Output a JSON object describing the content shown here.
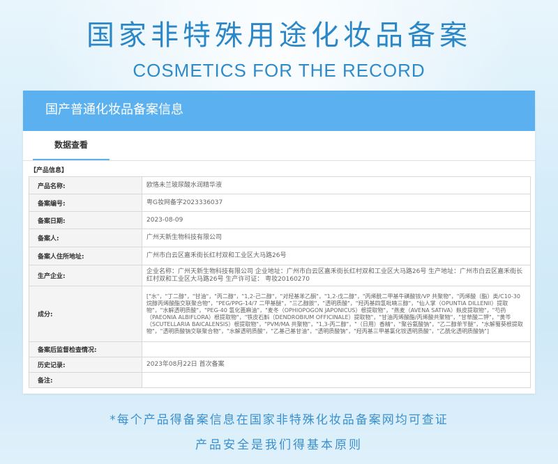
{
  "banner": {
    "title": "国家非特殊用途化妆品备案",
    "subtitle": "COSMETICS FOR THE RECORD"
  },
  "card": {
    "header_title": "国产普通化妆品备案信息",
    "tab_label": "数据查看",
    "section_label": "【产品信息】",
    "rows": [
      {
        "key": "产品名称:",
        "value": "欧恪未兰玻尿酸水润精华液"
      },
      {
        "key": "备案编号:",
        "value": "粤G妆网备字2023336037"
      },
      {
        "key": "备案日期:",
        "value": "2023-08-09"
      },
      {
        "key": "备案人:",
        "value": "广州天新生物科技有限公司"
      },
      {
        "key": "备案人住所地址:",
        "value": "广州市白云区嘉禾街长红村双和工业区大马路26号"
      },
      {
        "key": "生产企业:",
        "value": "企业名称：广州天新生物科技有限公司 企业地址：广州市白云区嘉禾街长红村双和工业区大马路26号 生产地址：广州市白云区嘉禾街长红村双和工业区大马路26号 生产许可证： 粤妆20160270"
      },
      {
        "key": "成分:",
        "value": "[\"水\"，\"丁二醇\"，\"甘油\"，\"丙二醇\"，\"1,2-己二醇\"，\"对羟基苯乙酮\"，\"1,2-戊二醇\"，\"丙烯酰二甲基牛磺酸铵/VP 共聚物\"，\"丙烯酸（酯）类/C10-30 烷醇丙烯酸酯交联聚合物\"，\"PEG/PPG-14/7 二甲基醚\"，\"三乙醇胺\"，\"透明质酸\"，\"羟丙基四氢吡喃三醇\"，\"仙人掌（OPUNTIA DILLENII）提取物\"，\"水解透明质酸\"，\"PEG-40 氢化蓖麻油\"，\"麦冬（OPHIOPOGON JAPONICUS）根提取物\"，\"燕麦（AVENA SATIVA）麸皮提取物\"，\"芍药（PAEONIA ALBIFLORA）根提取物\"，\"铁皮石斛（DENDROBIUM OFFICINALE）提取物\"，\"甘油丙烯酸酯/丙烯酸共聚物\"，\"甘草酸二钾\"，\"黄芩（SCUTELLARIA BAICALENSIS）根提取物\"，\"PVM/MA 共聚物\"，\"1,3-丙二醇\"，\"（日用）香精\"，\"聚谷氨酸钠\"，\"乙二醇单苄醚\"，\"水解蜀葵根提取物\"，\"透明质酸钠交联聚合物\"，\"水解透明质酸\"，\"乙基己基甘油\"，\"透明质酸钠\"，\"羟丙基三甲基氯化铵透明质酸\"，\"乙酰化透明质酸钠\"]"
      },
      {
        "key": "备案后监督检查情况:",
        "value": ""
      },
      {
        "key": "历史记录:",
        "value": "2023年08月22日 首次备案"
      },
      {
        "key": "备注:",
        "value": ""
      }
    ]
  },
  "footer": {
    "note": "*每个产品得备案信息在国家非特殊化妆品备案网均可查证",
    "principle": "产品安全是我们得基本原则"
  },
  "colors": {
    "accent": "#5bb1ef",
    "title_blue": "#2b87c6"
  }
}
